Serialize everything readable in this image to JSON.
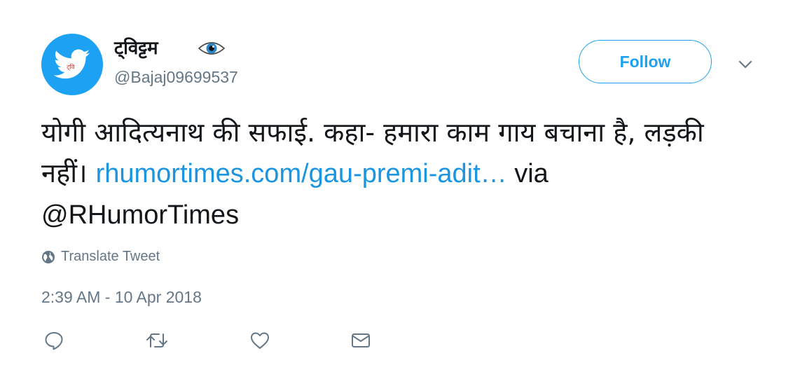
{
  "author": {
    "display_name": "ट्विट्टम",
    "handle": "@Bajaj09699537",
    "avatar_icon": "twitter-bird-icon",
    "name_emoji": "eye-icon"
  },
  "header": {
    "follow_label": "Follow",
    "menu_icon": "chevron-down-icon"
  },
  "tweet": {
    "text_part1": "योगी आदित्यनाथ की सफाई. कहा- हमारा काम गाय बचाना है, लड़की नहीं। ",
    "link_text": "rhumortimes.com/gau-premi-adit…",
    "text_part2": " via ",
    "mention": "@RHumorTimes",
    "translate_label": "Translate Tweet",
    "timestamp": "2:39 AM - 10 Apr 2018"
  },
  "colors": {
    "accent": "#1da1f2",
    "link": "#1b95e0",
    "secondary_text": "#657786",
    "primary_text": "#14171a"
  },
  "actions": [
    {
      "name": "reply",
      "icon": "reply-icon"
    },
    {
      "name": "retweet",
      "icon": "retweet-icon"
    },
    {
      "name": "like",
      "icon": "heart-icon"
    },
    {
      "name": "message",
      "icon": "envelope-icon"
    }
  ]
}
